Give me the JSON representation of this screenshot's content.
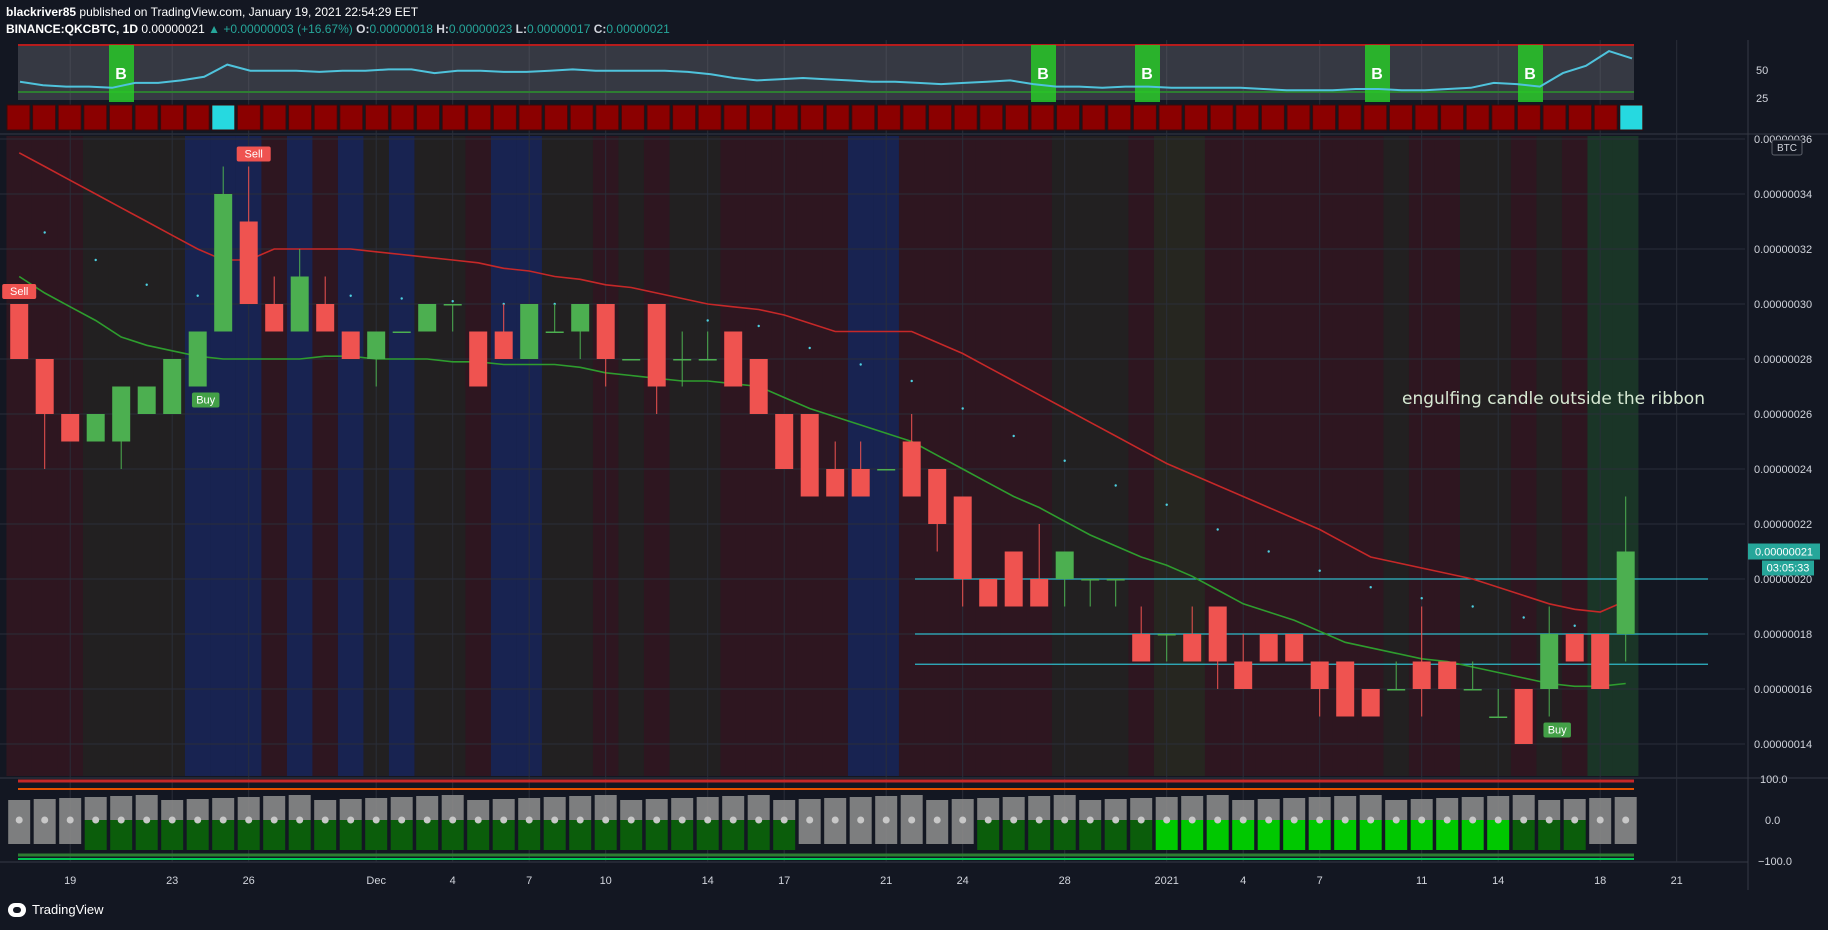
{
  "header": {
    "publisher": "blackriver85",
    "published_text": "published on TradingView.com, January 19, 2021 22:54:29 EET",
    "symbol": "BINANCE:QKCBTC, 1D",
    "last": "0.00000021",
    "change": "+0.00000003 (+16.67%)",
    "o_label": "O:",
    "o": "0.00000018",
    "h_label": "H:",
    "h": "0.00000023",
    "l_label": "L:",
    "l": "0.00000017",
    "c_label": "C:",
    "c": "0.00000021"
  },
  "annotation": "engulfing candle outside the ribbon",
  "price_axis": {
    "currency": "BTC",
    "last_price_label": "0.00000021",
    "countdown_label": "03:05:33"
  },
  "oscillator_axis": [
    "50",
    "25"
  ],
  "bottom_axis": [
    "100.0",
    "0.0",
    "−100.0"
  ],
  "signals": {
    "buy": "Buy",
    "sell": "Sell",
    "b_marker": "B"
  },
  "branding": "TradingView",
  "colors": {
    "background": "#131722",
    "up": "#26a69a",
    "candle_up": "#4caf50",
    "candle_down": "#ef5350",
    "ma_red": "#c62828",
    "ma_green": "#2e9d2e",
    "hline": "#2fb9c9"
  },
  "chart_data": {
    "type": "candlestick",
    "symbol": "BINANCE:QKCBTC",
    "interval": "1D",
    "price_scale": "1e-8 BTC",
    "ylim": [
      13,
      36
    ],
    "yticks": [
      "0.00000036",
      "0.00000034",
      "0.00000032",
      "0.00000030",
      "0.00000028",
      "0.00000026",
      "0.00000024",
      "0.00000022",
      "0.00000020",
      "0.00000018",
      "0.00000016",
      "0.00000014"
    ],
    "xticks": [
      {
        "label": "19",
        "i": 2
      },
      {
        "label": "23",
        "i": 6
      },
      {
        "label": "26",
        "i": 9
      },
      {
        "label": "Dec",
        "i": 14
      },
      {
        "label": "4",
        "i": 17
      },
      {
        "label": "7",
        "i": 20
      },
      {
        "label": "10",
        "i": 23
      },
      {
        "label": "14",
        "i": 27
      },
      {
        "label": "17",
        "i": 30
      },
      {
        "label": "21",
        "i": 34
      },
      {
        "label": "24",
        "i": 37
      },
      {
        "label": "28",
        "i": 41
      },
      {
        "label": "2021",
        "i": 45
      },
      {
        "label": "4",
        "i": 48
      },
      {
        "label": "7",
        "i": 51
      },
      {
        "label": "11",
        "i": 55
      },
      {
        "label": "14",
        "i": 58
      },
      {
        "label": "18",
        "i": 62
      },
      {
        "label": "21",
        "i": 65
      }
    ],
    "candles": [
      [
        30,
        30,
        28,
        28
      ],
      [
        28,
        28,
        24,
        26
      ],
      [
        26,
        26,
        25,
        25
      ],
      [
        25,
        26,
        25,
        26
      ],
      [
        25,
        27,
        24,
        27
      ],
      [
        26,
        27,
        26,
        27
      ],
      [
        26,
        28,
        26,
        28
      ],
      [
        27,
        29,
        27,
        29
      ],
      [
        29,
        35,
        29,
        34
      ],
      [
        33,
        35,
        30,
        30
      ],
      [
        30,
        31,
        29,
        29
      ],
      [
        29,
        32,
        29,
        31
      ],
      [
        30,
        31,
        29,
        29
      ],
      [
        29,
        29,
        28,
        28
      ],
      [
        28,
        29,
        27,
        29
      ],
      [
        29,
        29,
        29,
        29
      ],
      [
        29,
        30,
        29,
        30
      ],
      [
        30,
        30,
        29,
        30
      ],
      [
        29,
        29,
        27,
        27
      ],
      [
        29,
        30,
        28,
        28
      ],
      [
        28,
        30,
        28,
        30
      ],
      [
        29,
        30,
        29,
        29
      ],
      [
        29,
        30,
        28,
        30
      ],
      [
        30,
        30,
        27,
        28
      ],
      [
        28,
        28,
        28,
        28
      ],
      [
        30,
        30,
        26,
        27
      ],
      [
        28,
        29,
        27,
        28
      ],
      [
        28,
        29,
        28,
        28
      ],
      [
        29,
        29,
        27,
        27
      ],
      [
        28,
        28,
        26,
        26
      ],
      [
        26,
        26,
        24,
        24
      ],
      [
        26,
        26,
        23,
        23
      ],
      [
        24,
        25,
        23,
        23
      ],
      [
        24,
        25,
        23,
        23
      ],
      [
        24,
        24,
        24,
        24
      ],
      [
        25,
        26,
        23,
        23
      ],
      [
        24,
        24,
        21,
        22
      ],
      [
        23,
        23,
        19,
        20
      ],
      [
        20,
        20,
        19,
        19
      ],
      [
        21,
        21,
        19,
        19
      ],
      [
        20,
        22,
        19,
        19
      ],
      [
        20,
        21,
        19,
        21
      ],
      [
        20,
        20,
        19,
        20
      ],
      [
        20,
        20,
        19,
        20
      ],
      [
        18,
        19,
        17,
        17
      ],
      [
        18,
        18,
        17,
        18
      ],
      [
        18,
        19,
        17,
        17
      ],
      [
        19,
        19,
        16,
        17
      ],
      [
        17,
        18,
        16,
        16
      ],
      [
        18,
        18,
        17,
        17
      ],
      [
        18,
        18,
        17,
        17
      ],
      [
        17,
        17,
        15,
        16
      ],
      [
        17,
        17,
        15,
        15
      ],
      [
        16,
        16,
        15,
        15
      ],
      [
        16,
        17,
        16,
        16
      ],
      [
        17,
        19,
        15,
        16
      ],
      [
        17,
        17,
        16,
        16
      ],
      [
        16,
        17,
        16,
        16
      ],
      [
        15,
        16,
        15,
        15
      ],
      [
        16,
        16,
        14,
        14
      ],
      [
        16,
        19,
        15,
        18
      ],
      [
        18,
        18,
        17,
        17
      ],
      [
        18,
        18,
        16,
        16
      ],
      [
        18,
        23,
        17,
        21
      ]
    ],
    "candle_fields": [
      "open",
      "high",
      "low",
      "close"
    ],
    "ma_red": [
      35.5,
      35,
      34.5,
      34,
      33.5,
      33,
      32.5,
      32,
      31.6,
      31.6,
      32,
      32,
      32,
      32,
      31.9,
      31.8,
      31.7,
      31.6,
      31.5,
      31.3,
      31.2,
      31,
      30.9,
      30.7,
      30.6,
      30.4,
      30.2,
      30,
      29.9,
      29.8,
      29.6,
      29.3,
      29,
      29,
      29,
      29,
      28.6,
      28.2,
      27.7,
      27.2,
      26.7,
      26.2,
      25.7,
      25.2,
      24.7,
      24.2,
      23.8,
      23.4,
      23,
      22.6,
      22.2,
      21.8,
      21.3,
      20.8,
      20.6,
      20.4,
      20.2,
      20,
      19.7,
      19.4,
      19.1,
      18.9,
      18.8,
      19.2
    ],
    "ma_green": [
      31,
      30.4,
      29.9,
      29.4,
      28.8,
      28.5,
      28.3,
      28.1,
      28,
      28,
      28,
      28,
      28.1,
      28.1,
      28,
      28,
      28,
      27.9,
      27.9,
      27.8,
      27.8,
      27.8,
      27.7,
      27.5,
      27.4,
      27.3,
      27.2,
      27.2,
      27.1,
      27,
      26.6,
      26.2,
      25.9,
      25.6,
      25.3,
      25,
      24.5,
      24,
      23.5,
      23,
      22.6,
      22.1,
      21.6,
      21.2,
      20.8,
      20.5,
      20.1,
      19.6,
      19.1,
      18.8,
      18.5,
      18.1,
      17.7,
      17.5,
      17.3,
      17.1,
      17,
      16.8,
      16.6,
      16.4,
      16.2,
      16.1,
      16.1,
      16.2
    ],
    "buy_signals": [
      7,
      60
    ],
    "sell_signals": [
      0,
      9
    ],
    "horizontal_lines": [
      20,
      18,
      16.9
    ],
    "oscillator": {
      "values": [
        35,
        32,
        31,
        31,
        30,
        34,
        34,
        36,
        39,
        49,
        44,
        44,
        44,
        43,
        44,
        44,
        45,
        45,
        42,
        44,
        44,
        43,
        43,
        44,
        45,
        44,
        44,
        44,
        44,
        43,
        41,
        38,
        36,
        37,
        38,
        37,
        36,
        35,
        35,
        34,
        33,
        34,
        35,
        36,
        33,
        31,
        31,
        30,
        31,
        31,
        30,
        30,
        30,
        30,
        29,
        28,
        28,
        28,
        29,
        29,
        28,
        28,
        29,
        30,
        34,
        33,
        31,
        42,
        48,
        60,
        54
      ],
      "b_markers": [
        3,
        40,
        44,
        53,
        59
      ]
    }
  }
}
